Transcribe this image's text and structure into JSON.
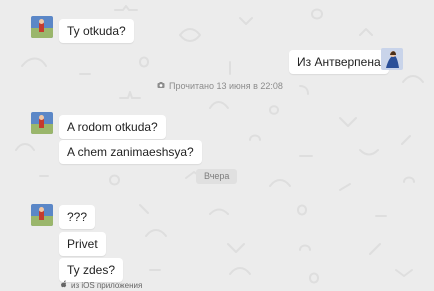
{
  "conversation": {
    "messages": [
      {
        "side": "incoming",
        "text": "Ty otkuda?"
      },
      {
        "side": "outgoing",
        "text": "Из Антверпена"
      },
      {
        "side": "incoming",
        "text": "A rodom otkuda?"
      },
      {
        "side": "incoming",
        "text": "A chem zanimaeshsya?"
      },
      {
        "side": "incoming",
        "text": "???"
      },
      {
        "side": "incoming",
        "text": "Privet"
      },
      {
        "side": "incoming",
        "text": "Ty zdes?"
      }
    ],
    "read_status": "Прочитано 13 июня в 22:08",
    "date_divider": "Вчера",
    "footer_status": "из iOS приложения"
  },
  "icons": {
    "read_status_icon": "eye-icon",
    "footer_icon": "apple-icon"
  },
  "colors": {
    "background": "#ececec",
    "bubble": "#ffffff",
    "text": "#222222",
    "muted": "#8c8c8c",
    "divider_bg": "#e0e0e0"
  }
}
